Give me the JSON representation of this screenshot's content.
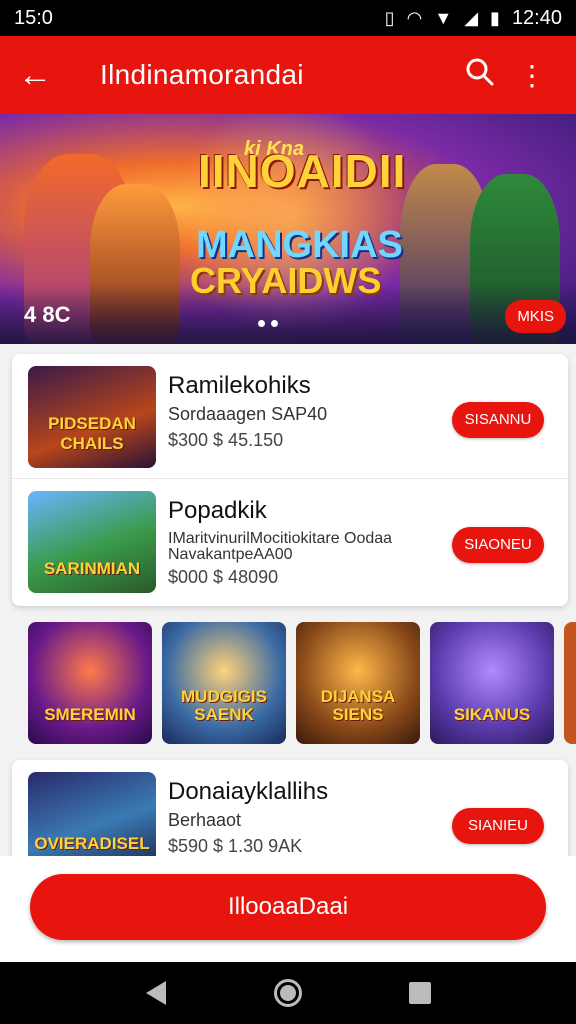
{
  "status_bar": {
    "time_left": "15:0",
    "time_right": "12:40",
    "icons": [
      "vibrate-icon",
      "wifi-icon",
      "signal-icon",
      "signal-bars-icon",
      "battery-icon"
    ]
  },
  "app_bar": {
    "title": "Ilndinamorandai",
    "icons": [
      "back-arrow-icon",
      "search-icon",
      "more-vert-icon"
    ]
  },
  "banner": {
    "small_text": "ki Kna",
    "title_1": "IINOAIDII",
    "title_2": "MANGKIAS",
    "title_3": "CRYAIDWS",
    "corner_text": "4 8C",
    "button_label": "MKIS",
    "page_dots": 2
  },
  "cards": [
    {
      "name": "Ramilekohiks",
      "subtitle": "Sordaaagen SAP40",
      "price": "$300  $ 45.150",
      "thumb_label": "PIDSEDAN CHAILS",
      "button_label": "SISANNU"
    },
    {
      "name": "Popadkik",
      "subtitle": "IMaritvinurilMocitiokitare Oodaa NavakantpeAA00",
      "price": "$000  $ 48090",
      "thumb_label": "SARINMIAN",
      "button_label": "SIAONEU"
    }
  ],
  "tiles": [
    {
      "label": "SMEREMIN"
    },
    {
      "label": "MUDGIGIS SAENK"
    },
    {
      "label": "DIJANSA SIENS"
    },
    {
      "label": "SIKANUS"
    },
    {
      "label": ""
    }
  ],
  "card_bottom": {
    "name": "Donaiayklallihs",
    "subtitle": "Berhaaot",
    "price": "$590  $ 1.30 9AK",
    "thumb_label": "OVIERADISEL",
    "button_label": "SIANIEU"
  },
  "main_button": {
    "label": "IllooaaDaai"
  },
  "colors": {
    "accent": "#e8150f",
    "status_bar": "#000000",
    "nav_bar": "#000000"
  },
  "nav": {
    "icons": [
      "back-triangle-icon",
      "home-circle-icon",
      "recents-square-icon"
    ]
  }
}
